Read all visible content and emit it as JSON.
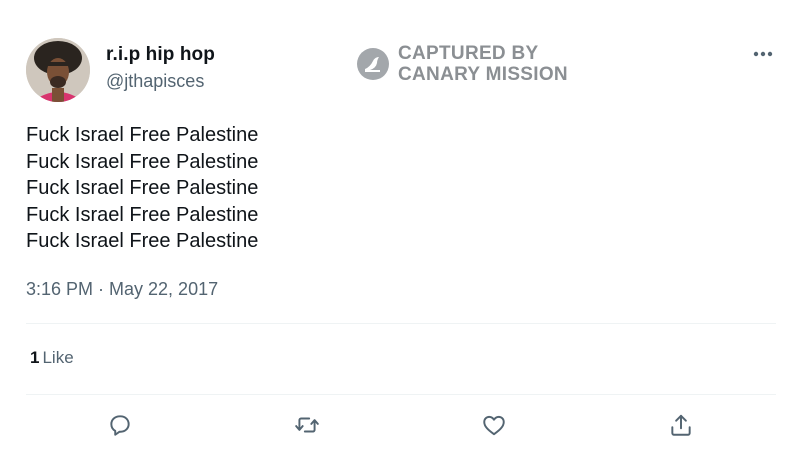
{
  "user": {
    "display_name": "r.i.p hip hop",
    "handle": "@jthapisces"
  },
  "watermark": {
    "line1": "CAPTURED BY",
    "line2": "CANARY MISSION"
  },
  "tweet": {
    "lines": [
      "Fuck Israel Free Palestine",
      "Fuck Israel Free Palestine",
      "Fuck Israel Free Palestine",
      "Fuck Israel Free Palestine",
      "Fuck Israel Free Palestine"
    ],
    "timestamp": "3:16 PM · May 22, 2017"
  },
  "engagement": {
    "likes_count": "1",
    "likes_label": "Like"
  },
  "actions": [
    {
      "name": "reply",
      "icon": "reply-icon"
    },
    {
      "name": "retweet",
      "icon": "retweet-icon"
    },
    {
      "name": "like",
      "icon": "heart-icon"
    },
    {
      "name": "share",
      "icon": "share-icon"
    }
  ],
  "colors": {
    "text_primary": "#0f1419",
    "text_secondary": "#536471",
    "watermark": "#8b8f93",
    "divider": "#eff3f4"
  }
}
